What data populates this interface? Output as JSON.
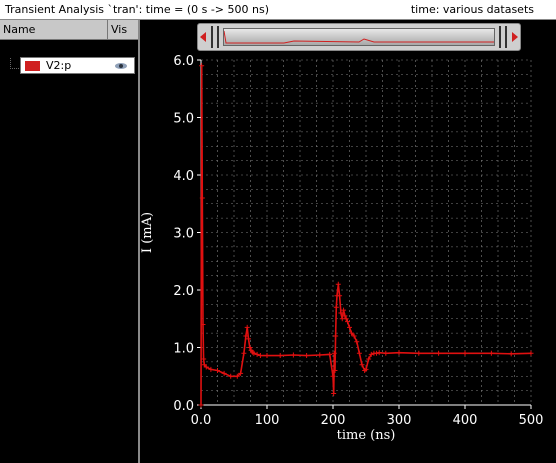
{
  "window": {
    "title": "Transient Analysis `tran': time = (0 s -> 500 ns)",
    "right_info": "time: various datasets"
  },
  "signal_list": {
    "columns": {
      "name": "Name",
      "visible": "Vis"
    },
    "items": [
      {
        "name": "V2:p",
        "color": "#d02020",
        "visible_icon": "eye-icon"
      }
    ]
  },
  "colors": {
    "trace": "#e01010",
    "background": "#000000",
    "grid": "#808080",
    "text": "#ffffff"
  },
  "chart_data": {
    "type": "line",
    "xlabel": "time (ns)",
    "ylabel": "I (mA)",
    "xlim": [
      0,
      500
    ],
    "ylim": [
      0,
      6
    ],
    "grid": true,
    "x_ticks": [
      0,
      100,
      200,
      300,
      400,
      500
    ],
    "x_tick_labels": [
      "0.0",
      "100",
      "200",
      "300",
      "400",
      "500"
    ],
    "y_ticks": [
      0,
      1,
      2,
      3,
      4,
      5,
      6
    ],
    "y_tick_labels": [
      "0.0",
      "1.0",
      "2.0",
      "3.0",
      "4.0",
      "5.0",
      "6.0"
    ],
    "series": [
      {
        "x": [
          0,
          1,
          2,
          3,
          4,
          5,
          8,
          15,
          25,
          35,
          45,
          55,
          60,
          65,
          68,
          70,
          72,
          74,
          76,
          78,
          80,
          85,
          90,
          100,
          120,
          140,
          160,
          180,
          195,
          200,
          201,
          202,
          203,
          204,
          205,
          206,
          208,
          210,
          212,
          214,
          216,
          218,
          220,
          222,
          225,
          228,
          232,
          236,
          240,
          244,
          248,
          250,
          254,
          258,
          262,
          266,
          270,
          280,
          300,
          330,
          360,
          400,
          440,
          470,
          500
        ],
        "y": [
          0.0,
          5.9,
          3.6,
          1.4,
          0.8,
          0.7,
          0.66,
          0.62,
          0.6,
          0.55,
          0.5,
          0.5,
          0.55,
          0.9,
          1.2,
          1.35,
          1.15,
          1.0,
          0.95,
          0.92,
          0.9,
          0.88,
          0.86,
          0.86,
          0.86,
          0.87,
          0.86,
          0.87,
          0.88,
          0.5,
          0.2,
          0.9,
          0.6,
          1.2,
          1.7,
          1.9,
          2.1,
          1.9,
          1.6,
          1.5,
          1.65,
          1.55,
          1.5,
          1.45,
          1.35,
          1.25,
          1.2,
          1.1,
          0.9,
          0.7,
          0.6,
          0.62,
          0.8,
          0.88,
          0.9,
          0.9,
          0.91,
          0.9,
          0.91,
          0.9,
          0.9,
          0.9,
          0.9,
          0.89,
          0.9
        ]
      }
    ]
  }
}
